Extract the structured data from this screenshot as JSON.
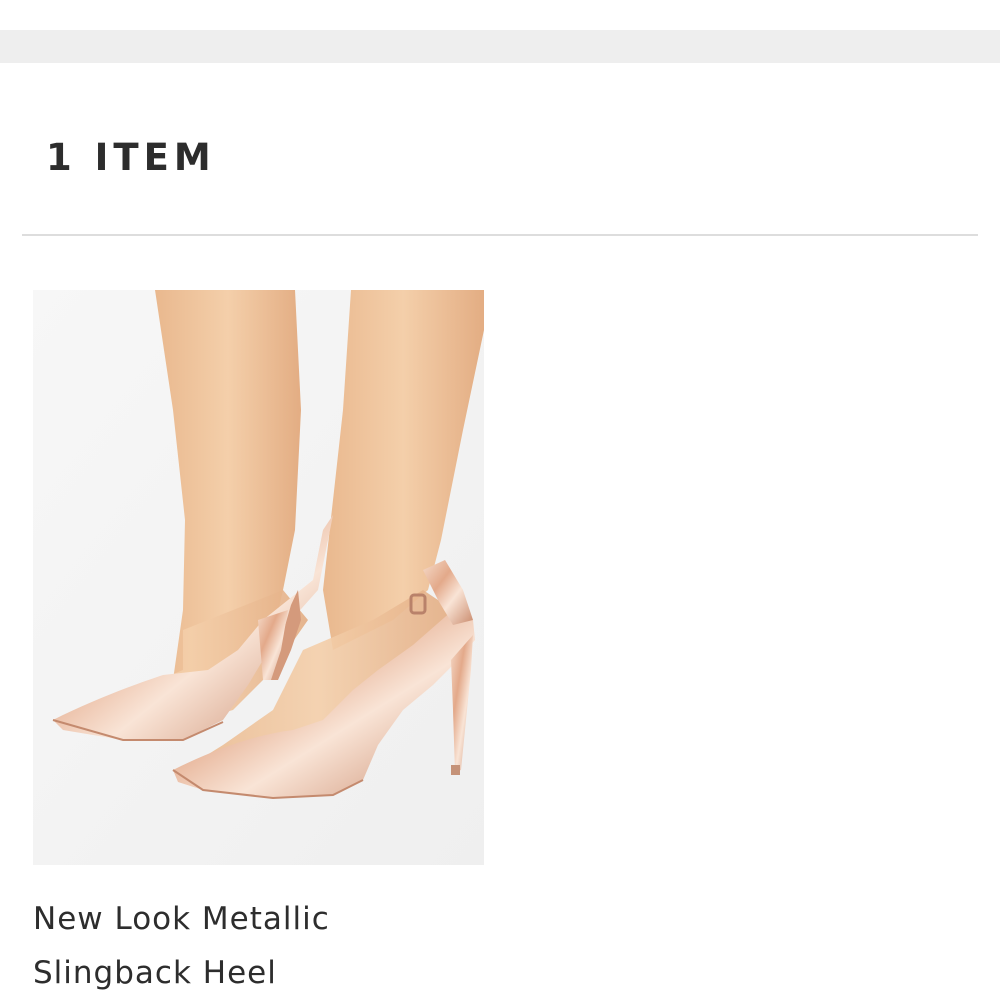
{
  "header": {
    "item_count_label": "1 ITEM"
  },
  "products": [
    {
      "name": "New Look Metallic\nSlingback Heel",
      "image_icon": "shoe-photo",
      "image_description_colors": {
        "background": "#f5f5f5",
        "skin": "#f0c7a0",
        "shoe": "#e8b89a"
      }
    }
  ]
}
